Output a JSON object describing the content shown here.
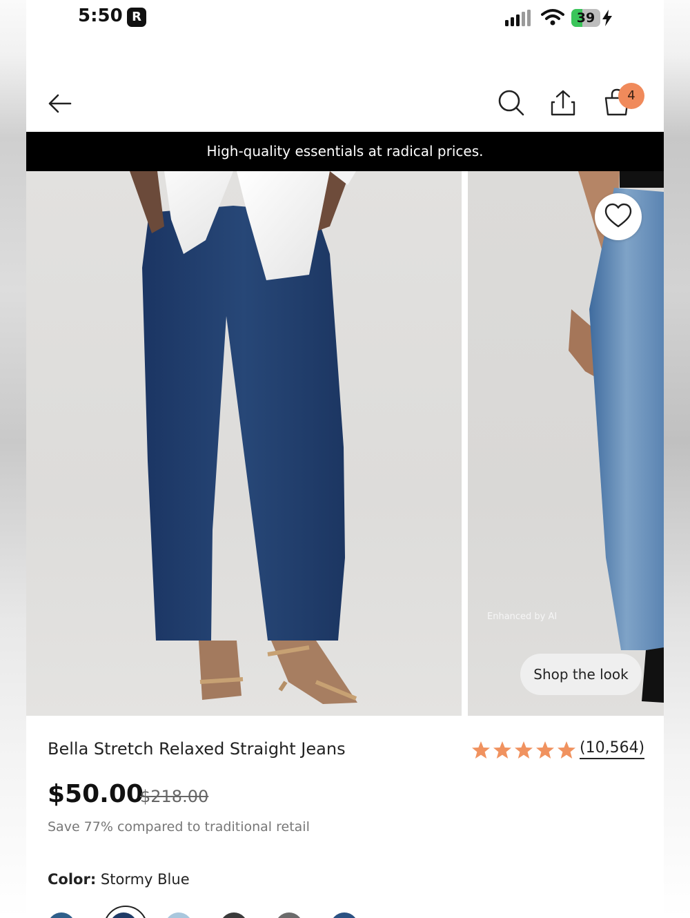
{
  "status_bar": {
    "time": "5:50",
    "app_badge": "R",
    "battery_level": "39",
    "battery_fraction": 0.39
  },
  "header": {
    "cart_count": "4"
  },
  "promo_banner": {
    "text": "High-quality essentials at radical prices."
  },
  "gallery": {
    "watermark": "Enhanced by AI",
    "shop_the_look_label": "Shop the look"
  },
  "product": {
    "title": "Bella Stretch Relaxed Straight Jeans",
    "rating_stars": 5,
    "review_count": "(10,564)",
    "price": "$50.00",
    "original_price": "$218.00",
    "savings_text": "Save 77% compared to traditional retail",
    "color_label": "Color:",
    "color_value": "Stormy Blue",
    "swatch_colors": [
      "#2f5f8a",
      "#1f3b66",
      "#a9c7dd",
      "#3a3a3a",
      "#6b6b6b",
      "#2b5182"
    ]
  },
  "colors": {
    "accent": "#f08a5b",
    "star": "#f0925f",
    "promo_bg": "#000000"
  }
}
